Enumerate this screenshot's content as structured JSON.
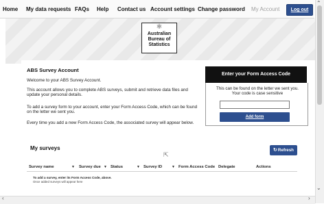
{
  "nav": {
    "home": "Home",
    "my_data_requests": "My data requests",
    "faqs": "FAQs",
    "help": "Help",
    "contact_us": "Contact us",
    "account_settings": "Account settings",
    "change_password": "Change password",
    "my_account": "My Account",
    "log_out": "Log out"
  },
  "logo": {
    "line1": "Australian",
    "line2": "Bureau of",
    "line3": "Statistics"
  },
  "account": {
    "title": "ABS Survey Account",
    "welcome": "Welcome to your ABS Survey Account.",
    "para1a": "This account allows you to complete ABS surveys, submit and retrieve data files and",
    "para1b": "update your personal details.",
    "para2a": "To add a survey form to your account, enter your Form Access Code, which can be found",
    "para2b": "on the letter we sent you.",
    "para3": "Every time you add a new Form Access Code, the associated survey will appear below."
  },
  "form_access": {
    "header": "Enter your Form Access Code",
    "help_line1": "This can be found on the letter we sent you.",
    "help_line2": "Your code is case sensitive",
    "input_value": "",
    "add_label": "Add form"
  },
  "surveys": {
    "title": "My surveys",
    "refresh_label": "Refresh",
    "columns": [
      "Survey name",
      "Survey due",
      "Status",
      "Survey ID",
      "Form Access Code",
      "Delegate",
      "Actions"
    ],
    "empty_line1": "To add a survey, enter its Form Access Code, above.",
    "empty_line2": "Once added surveys will appear here"
  },
  "colors": {
    "accent": "#2d4f8f",
    "header_dark": "#111111"
  }
}
